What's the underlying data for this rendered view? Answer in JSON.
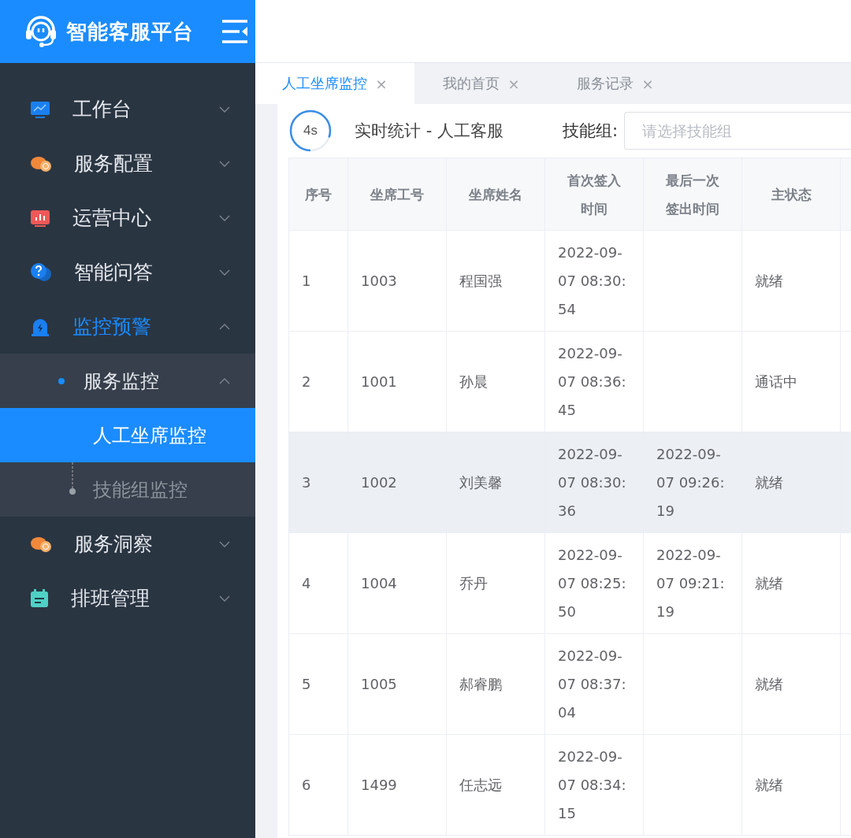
{
  "brand": {
    "title": "智能客服平台"
  },
  "sidebar": {
    "items": [
      {
        "label": "工作台",
        "expanded": false,
        "selected": false
      },
      {
        "label": "服务配置",
        "expanded": false,
        "selected": false
      },
      {
        "label": "运营中心",
        "expanded": false,
        "selected": false
      },
      {
        "label": "智能问答",
        "expanded": false,
        "selected": false
      },
      {
        "label": "监控预警",
        "expanded": true,
        "selected": true,
        "children": [
          {
            "label": "服务监控",
            "expanded": true,
            "selected": false,
            "children": [
              {
                "label": "人工坐席监控",
                "selected": true
              },
              {
                "label": "技能组监控",
                "selected": false
              }
            ]
          }
        ]
      },
      {
        "label": "服务洞察",
        "expanded": false,
        "selected": false
      },
      {
        "label": "排班管理",
        "expanded": false,
        "selected": false
      }
    ]
  },
  "tabs": [
    {
      "label": "人工坐席监控",
      "close": "×",
      "selected": true
    },
    {
      "label": "我的首页",
      "close": "×",
      "selected": false
    },
    {
      "label": "服务记录",
      "close": "×",
      "selected": false
    }
  ],
  "panel": {
    "timer": {
      "label": "4s"
    },
    "title": "实时统计 - 人工客服",
    "filter_label": "技能组:",
    "filter_placeholder": "请选择技能组"
  },
  "table": {
    "columns": [
      "序号",
      "坐席工号",
      "坐席姓名",
      "首次签入时间",
      "最后一次签出时间",
      "主状态"
    ],
    "rows": [
      {
        "cells": [
          "1",
          "1003",
          "程国强",
          "2022-09-07 08:30:54",
          "",
          "就绪"
        ],
        "highlighted": false
      },
      {
        "cells": [
          "2",
          "1001",
          "孙晨",
          "2022-09-07 08:36:45",
          "",
          "通话中"
        ],
        "highlighted": false
      },
      {
        "cells": [
          "3",
          "1002",
          "刘美馨",
          "2022-09-07 08:30:36",
          "2022-09-07 09:26:19",
          "就绪"
        ],
        "highlighted": true
      },
      {
        "cells": [
          "4",
          "1004",
          "乔丹",
          "2022-09-07 08:25:50",
          "2022-09-07 09:21:19",
          "就绪"
        ],
        "highlighted": false
      },
      {
        "cells": [
          "5",
          "1005",
          "郝睿鹏",
          "2022-09-07 08:37:04",
          "",
          "就绪"
        ],
        "highlighted": false
      },
      {
        "cells": [
          "6",
          "1499",
          "任志远",
          "2022-09-07 08:34:15",
          "",
          "就绪"
        ],
        "highlighted": false
      }
    ]
  }
}
